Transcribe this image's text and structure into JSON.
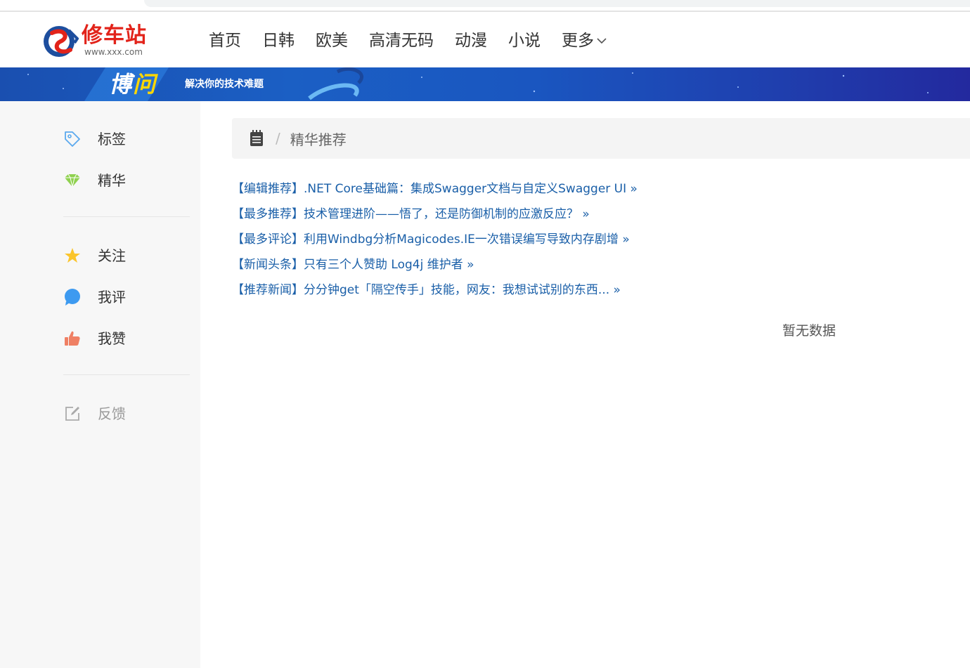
{
  "header": {
    "logo_name": "修车站",
    "logo_url": "www.xxx.com",
    "nav": [
      "首页",
      "日韩",
      "欧美",
      "高清无码",
      "动漫",
      "小说"
    ],
    "nav_more": "更多"
  },
  "banner": {
    "title_a": "博",
    "title_b": "问",
    "subtitle": "解决你的技术难题"
  },
  "sidebar": {
    "group1": [
      {
        "label": "标签",
        "icon": "tag-icon"
      },
      {
        "label": "精华",
        "icon": "diamond-icon"
      }
    ],
    "group2": [
      {
        "label": "关注",
        "icon": "star-icon"
      },
      {
        "label": "我评",
        "icon": "comment-icon"
      },
      {
        "label": "我赞",
        "icon": "thumbs-up-icon"
      }
    ],
    "group3": [
      {
        "label": "反馈",
        "icon": "edit-icon"
      }
    ]
  },
  "breadcrumb": {
    "separator": "/",
    "current": "精华推荐"
  },
  "links": [
    "【编辑推荐】.NET Core基础篇：集成Swagger文档与自定义Swagger UI »",
    "【最多推荐】技术管理进阶——悟了，还是防御机制的应激反应？ »",
    "【最多评论】利用Windbg分析Magicodes.IE一次错误编写导致内存剧增 »",
    "【新闻头条】只有三个人赞助 Log4j 维护者 »",
    "【推荐新闻】分分钟get「隔空传手」技能，网友：我想试试别的东西... »"
  ],
  "empty_text": "暂无数据",
  "colors": {
    "link": "#1a5fa8",
    "brand_red": "#e2231a",
    "banner_blue": "#1a56c0",
    "sidebar_bg": "#f7f7f7"
  }
}
